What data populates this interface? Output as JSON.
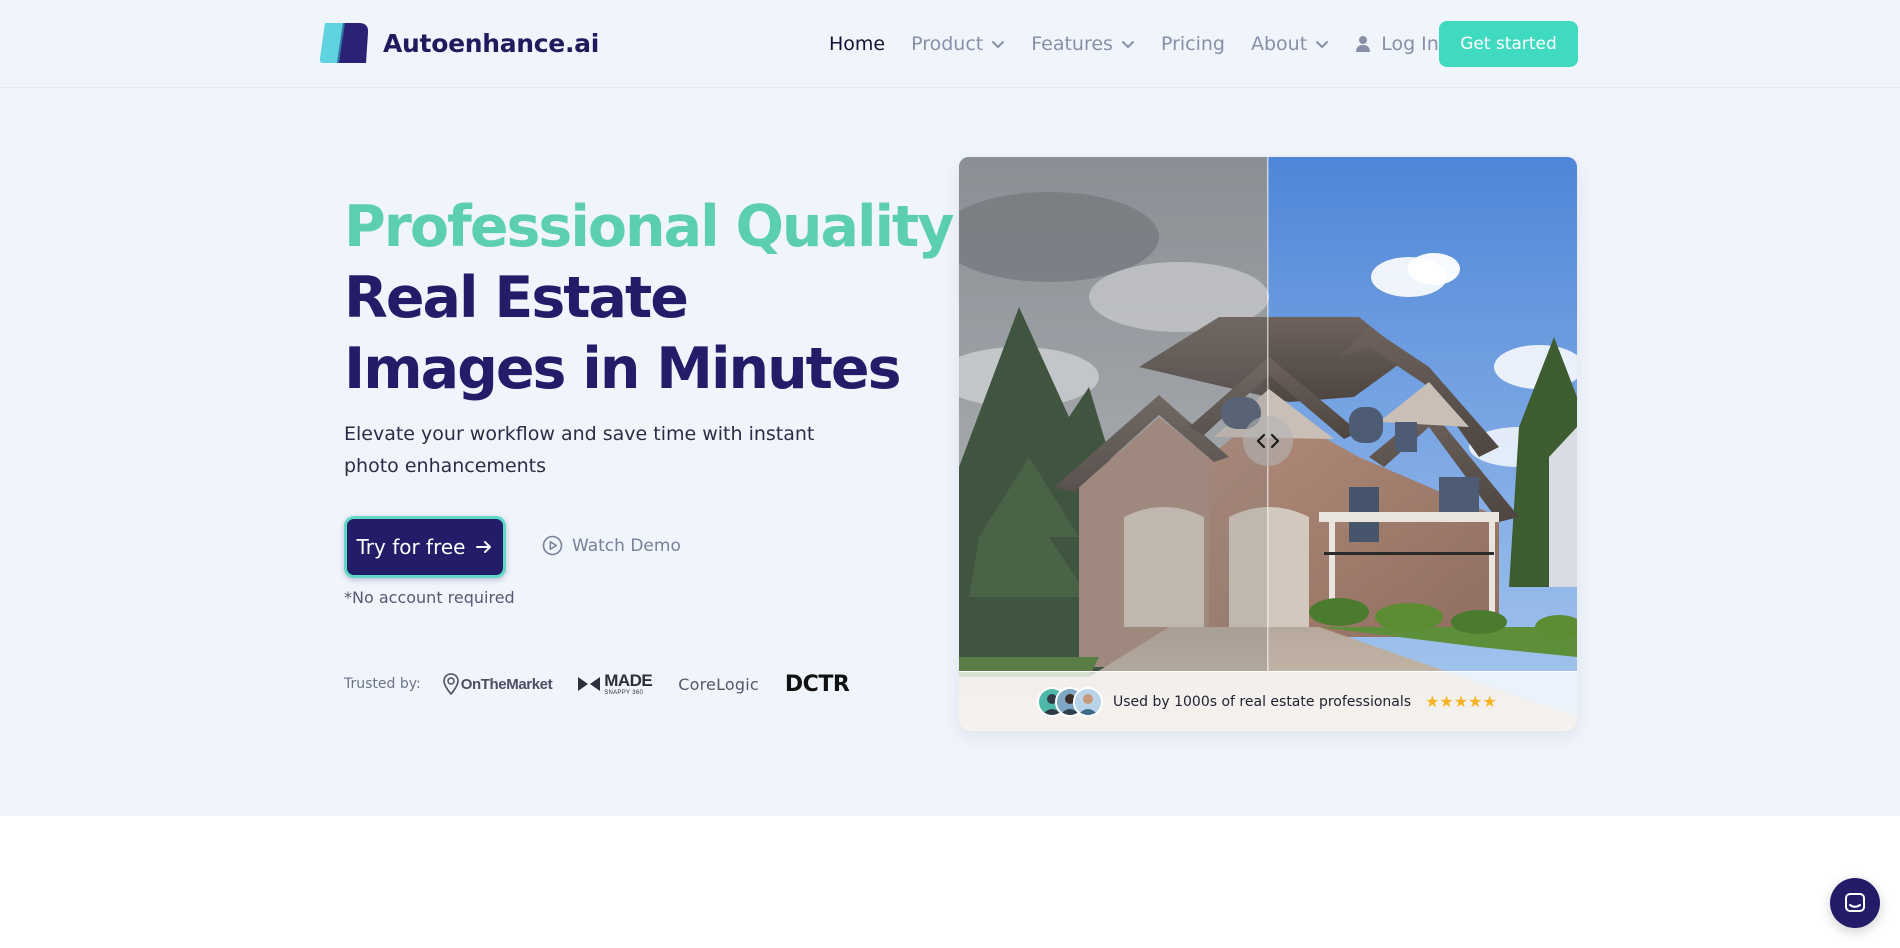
{
  "nav": {
    "brand": "Autoenhance.ai",
    "links": [
      {
        "label": "Home",
        "active": true,
        "dropdown": false
      },
      {
        "label": "Product",
        "active": false,
        "dropdown": true
      },
      {
        "label": "Features",
        "active": false,
        "dropdown": true
      },
      {
        "label": "Pricing",
        "active": false,
        "dropdown": false
      },
      {
        "label": "About",
        "active": false,
        "dropdown": true
      }
    ],
    "login_label": "Log In",
    "cta_label": "Get started"
  },
  "hero": {
    "headline_accent": "Professional Quality",
    "headline_main": "Real Estate Images in Minutes",
    "subheadline": "Elevate your workflow and save time with instant photo enhancements",
    "primary_button": "Try for free",
    "secondary_button": "Watch Demo",
    "note": "*No account required",
    "trusted_label": "Trusted by:",
    "logos": {
      "onthemarket": "OnTheMarket",
      "made_big": "MADE",
      "made_small": "SNAPPY 360",
      "corelogic": "CoreLogic",
      "dctr": "DCTR"
    }
  },
  "image_card": {
    "rating_text": "Used by 1000s of real estate professionals",
    "stars": "★★★★★",
    "rating": 5
  },
  "colors": {
    "accent_teal": "#3fdac0",
    "headline_teal": "#5ccfb0",
    "brand_navy": "#231d69",
    "star_gold": "#f5b423"
  }
}
